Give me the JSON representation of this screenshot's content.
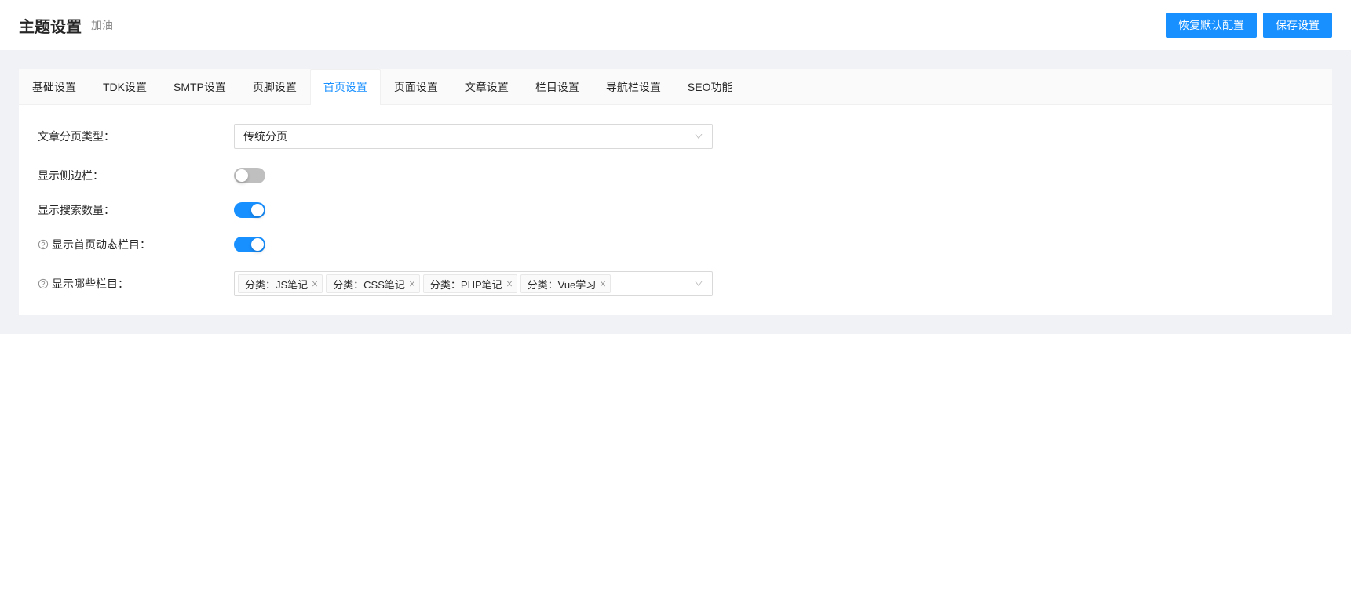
{
  "header": {
    "title": "主题设置",
    "subtitle": "加油",
    "restore_button": "恢复默认配置",
    "save_button": "保存设置"
  },
  "tabs": {
    "basic": "基础设置",
    "tdk": "TDK设置",
    "smtp": "SMTP设置",
    "footer": "页脚设置",
    "home": "首页设置",
    "page": "页面设置",
    "article": "文章设置",
    "column": "栏目设置",
    "nav": "导航栏设置",
    "seo": "SEO功能"
  },
  "form": {
    "pagination_type": {
      "label": "文章分页类型：",
      "value": "传统分页"
    },
    "show_sidebar": {
      "label": "显示侧边栏：",
      "value": false
    },
    "show_search_count": {
      "label": "显示搜索数量：",
      "value": true
    },
    "show_dynamic": {
      "label": "显示首页动态栏目：",
      "value": true
    },
    "show_columns": {
      "label": "显示哪些栏目：",
      "tags": {
        "t0": "分类：JS笔记",
        "t1": "分类：CSS笔记",
        "t2": "分类：PHP笔记",
        "t3": "分类：Vue学习"
      }
    }
  }
}
